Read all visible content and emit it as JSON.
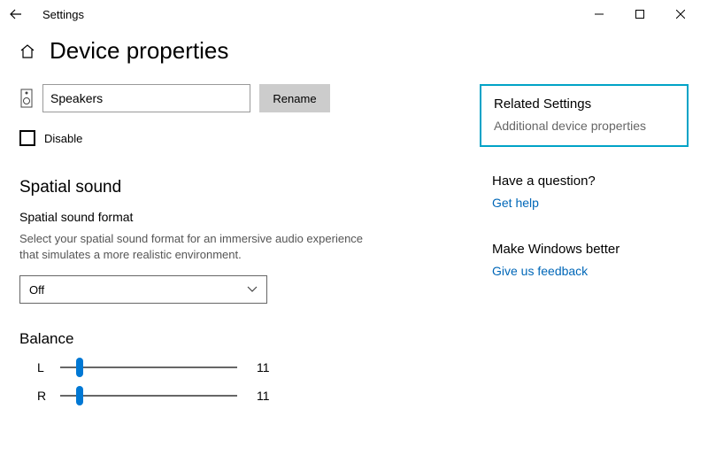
{
  "titlebar": {
    "app_name": "Settings"
  },
  "header": {
    "title": "Device properties"
  },
  "device": {
    "name_value": "Speakers",
    "rename_label": "Rename",
    "disable_label": "Disable"
  },
  "spatial": {
    "heading": "Spatial sound",
    "format_label": "Spatial sound format",
    "format_desc": "Select your spatial sound format for an immersive audio experience that simulates a more realistic environment.",
    "selected": "Off"
  },
  "balance": {
    "heading": "Balance",
    "left_label": "L",
    "left_value": "11",
    "right_label": "R",
    "right_value": "11"
  },
  "side": {
    "related_heading": "Related Settings",
    "additional_link": "Additional device properties",
    "question_heading": "Have a question?",
    "help_link": "Get help",
    "better_heading": "Make Windows better",
    "feedback_link": "Give us feedback"
  }
}
